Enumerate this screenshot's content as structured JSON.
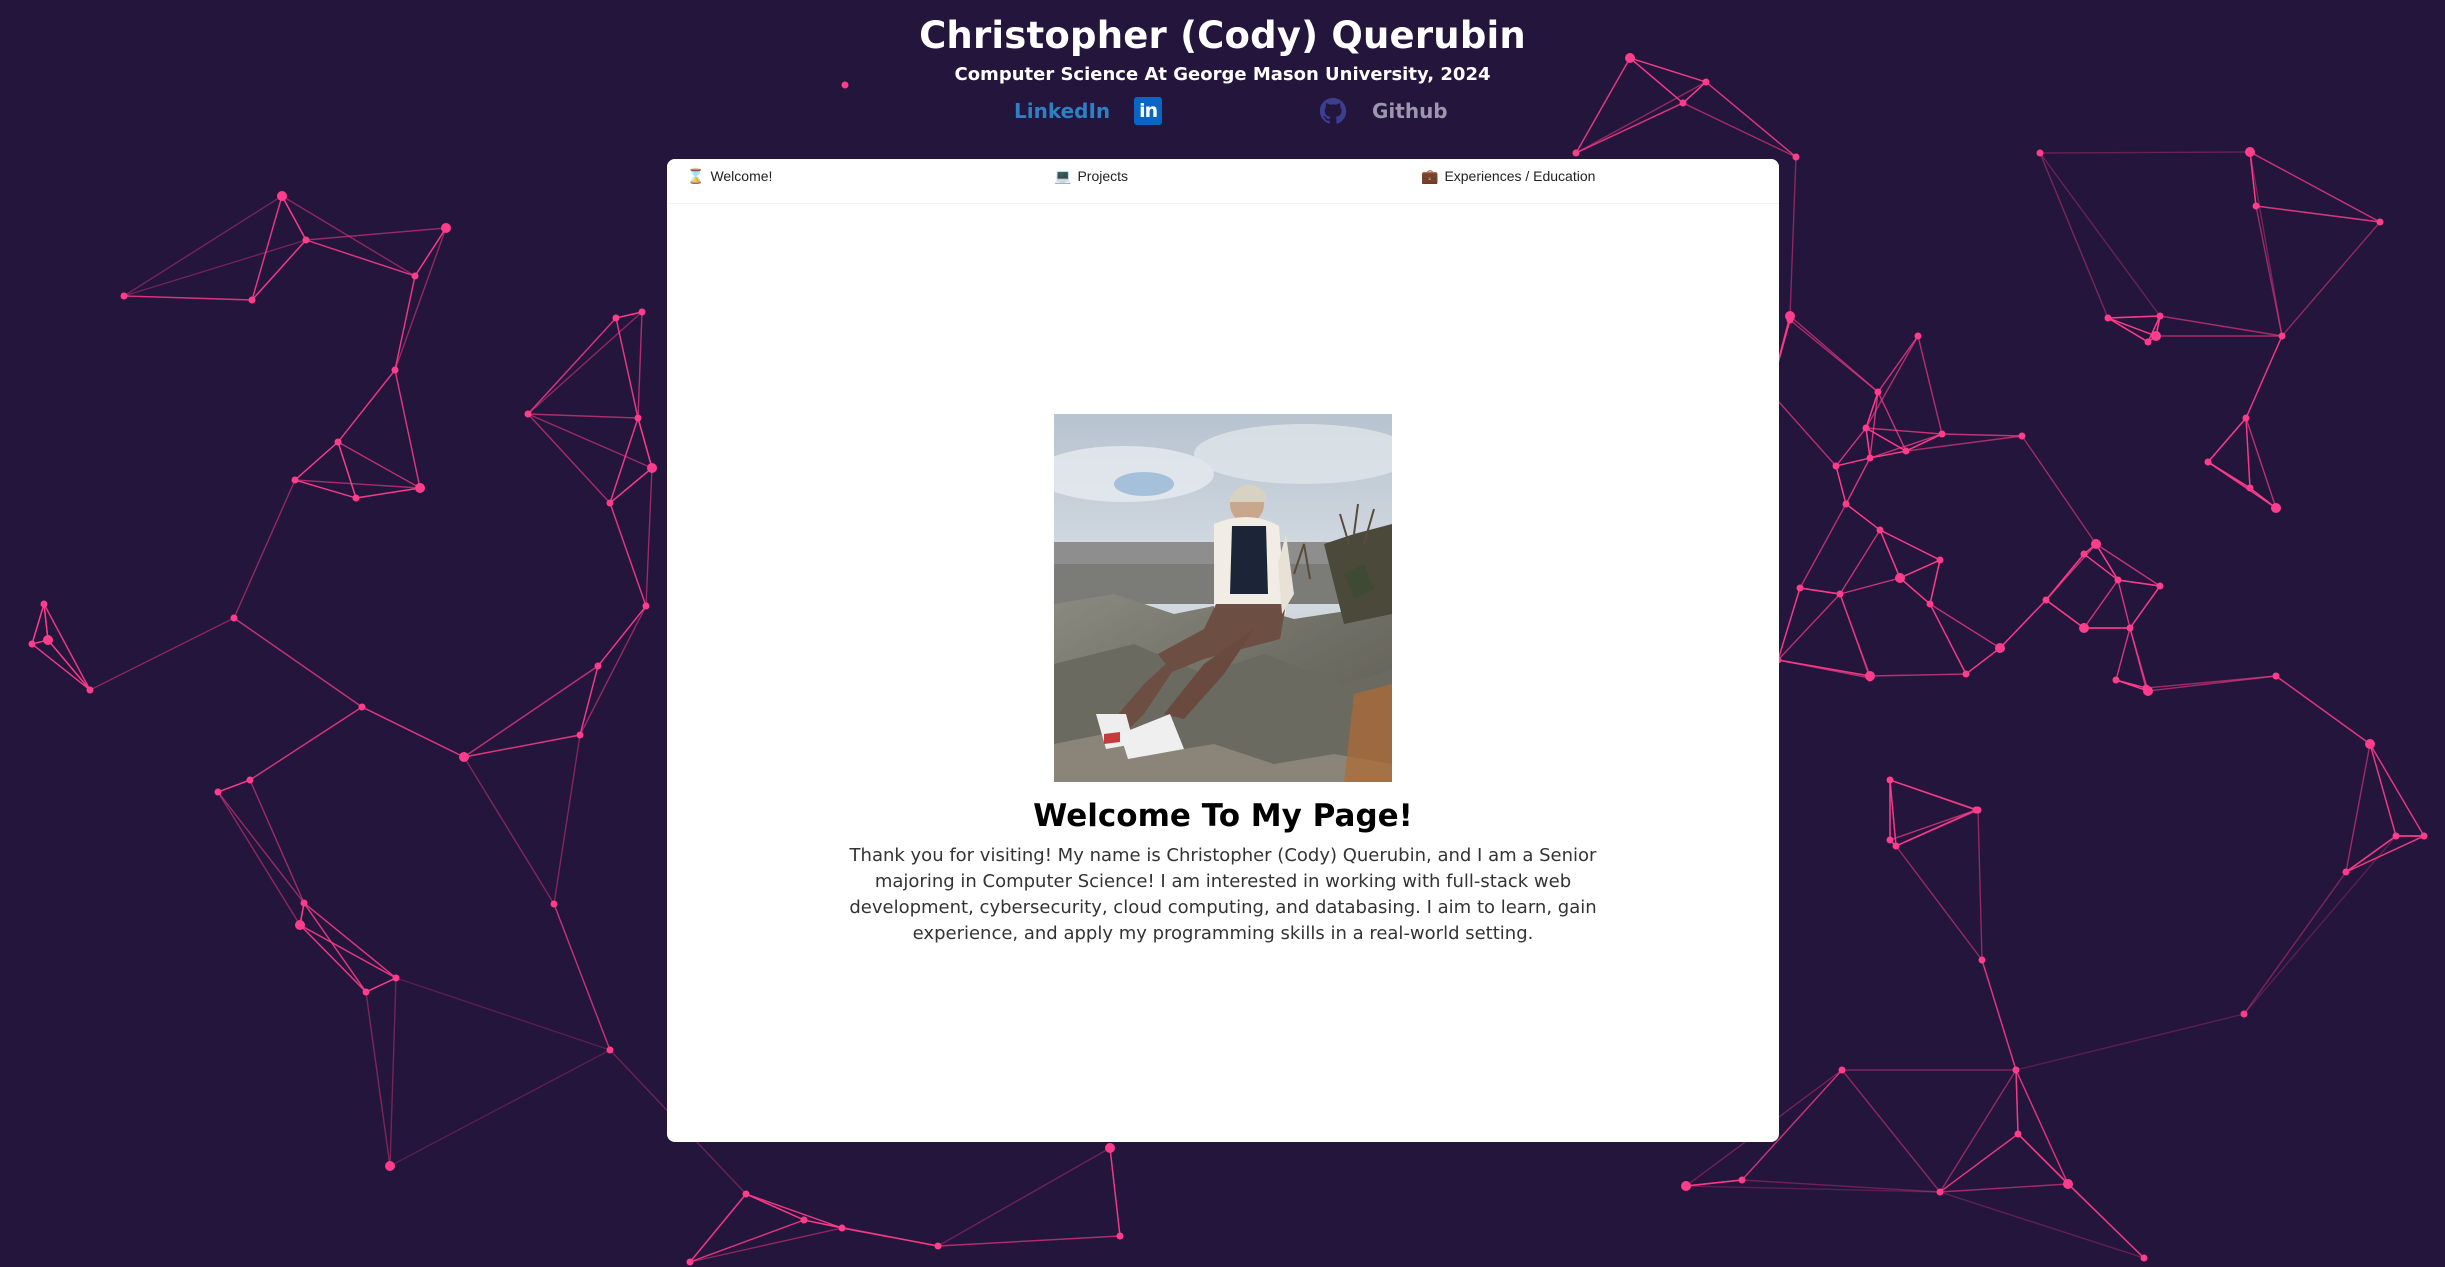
{
  "header": {
    "name": "Christopher (Cody) Querubin",
    "subtitle": "Computer Science At George Mason University, 2024",
    "links": {
      "linkedin_label": "LinkedIn",
      "linkedin_icon": "linkedin-icon",
      "github_label": "Github",
      "github_icon": "github-icon"
    }
  },
  "tabs": [
    {
      "label": "Welcome!",
      "icon": "hourglass-icon"
    },
    {
      "label": "Projects",
      "icon": "laptop-icon"
    },
    {
      "label": "Experiences / Education",
      "icon": "briefcase-icon"
    }
  ],
  "welcome": {
    "title": "Welcome To My Page!",
    "text": "Thank you for visiting! My name is Christopher (Cody) Querubin, and I am a Senior majoring in Computer Science! I am interested in working with full-stack web development, cybersecurity, cloud computing, and databasing. I aim to learn, gain experience, and apply my programming skills in a real-world setting."
  },
  "colors": {
    "background": "#23153b",
    "network": "#ff3d8b",
    "linkedin": "#2f7fc4",
    "github": "#9d97ad"
  }
}
